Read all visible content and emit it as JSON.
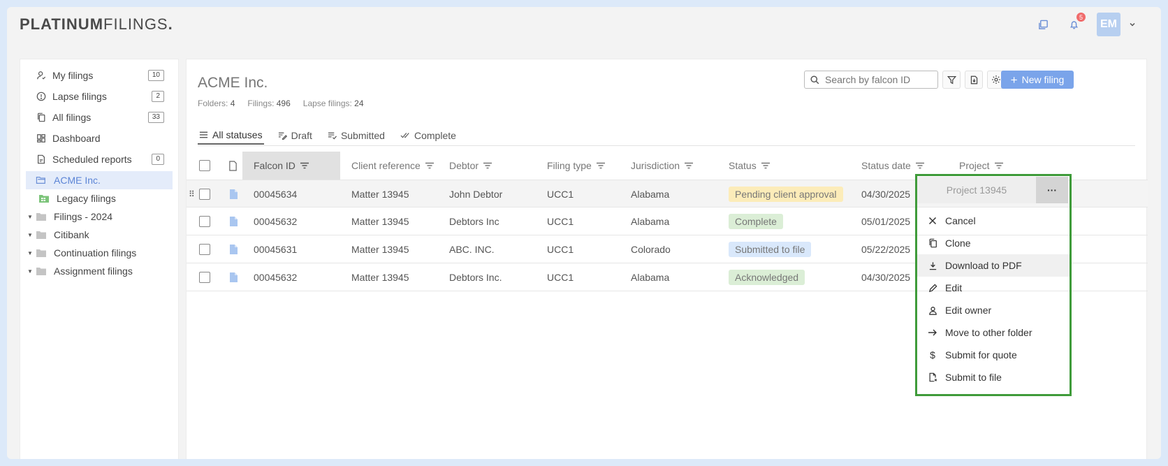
{
  "brand": {
    "bold": "PLATINUM",
    "light": "FILINGS",
    "dot": "."
  },
  "header": {
    "notifications_count": "5",
    "avatar_initials": "EM"
  },
  "sidebar": {
    "items": [
      {
        "label": "My filings",
        "count": "10",
        "icon": "user-check-icon"
      },
      {
        "label": "Lapse filings",
        "count": "2",
        "icon": "alert-circle-icon"
      },
      {
        "label": "All filings",
        "count": "33",
        "icon": "files-icon"
      },
      {
        "label": "Dashboard",
        "count": "",
        "icon": "dashboard-icon"
      },
      {
        "label": "Scheduled reports",
        "count": "0",
        "icon": "report-icon"
      }
    ],
    "selected_folder": "ACME Inc.",
    "tree": [
      {
        "label": "Legacy filings",
        "sub": true
      },
      {
        "label": "Filings - 2024"
      },
      {
        "label": "Citibank"
      },
      {
        "label": "Continuation filings"
      },
      {
        "label": "Assignment filings"
      }
    ]
  },
  "main": {
    "title": "ACME Inc.",
    "stats": {
      "folders_label": "Folders:",
      "folders": "4",
      "filings_label": "Filings:",
      "filings": "496",
      "lapse_label": "Lapse filings:",
      "lapse": "24"
    },
    "search_placeholder": "Search by falcon ID",
    "new_button": "New filing",
    "tabs": [
      "All statuses",
      "Draft",
      "Submitted",
      "Complete"
    ],
    "columns": [
      "Falcon ID",
      "Client reference",
      "Debtor",
      "Filing type",
      "Jurisdiction",
      "Status",
      "Status date",
      "Project"
    ],
    "rows": [
      {
        "id": "00045634",
        "ref": "Matter 13945",
        "debtor": "John Debtor",
        "type": "UCC1",
        "jur": "Alabama",
        "status": "Pending client approval",
        "date": "04/30/2025",
        "project": "Project 13945"
      },
      {
        "id": "00045632",
        "ref": "Matter 13945",
        "debtor": "Debtors Inc",
        "type": "UCC1",
        "jur": "Alabama",
        "status": "Complete",
        "date": "05/01/2025"
      },
      {
        "id": "00045631",
        "ref": "Matter 13945",
        "debtor": "ABC. INC.",
        "type": "UCC1",
        "jur": "Colorado",
        "status": "Submitted to file",
        "date": "05/22/2025"
      },
      {
        "id": "00045632",
        "ref": "Matter 13945",
        "debtor": "Debtors Inc.",
        "type": "UCC1",
        "jur": "Alabama",
        "status": "Acknowledged",
        "date": "04/30/2025"
      }
    ]
  },
  "menu": {
    "more": "···",
    "items": [
      "Cancel",
      "Clone",
      "Download to PDF",
      "Edit",
      "Edit owner",
      "Move to other folder",
      "Submit for quote",
      "Submit to file"
    ]
  },
  "colors": {
    "accent": "#7aa4ea",
    "highlight": "#3f9b3a"
  }
}
